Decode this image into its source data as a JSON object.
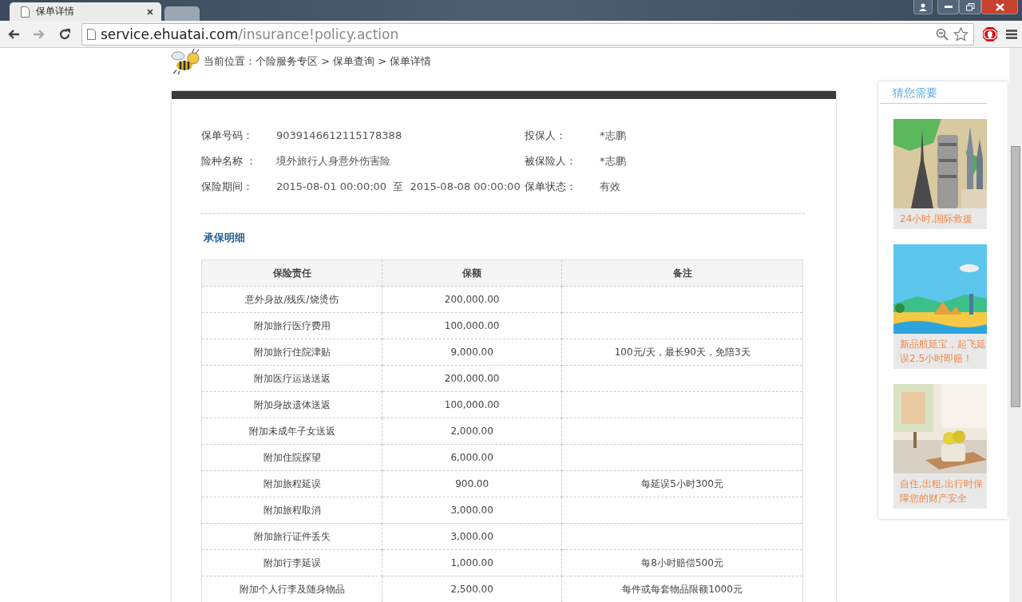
{
  "browser": {
    "tabs": [
      {
        "title": "保单详情",
        "selected": true
      },
      {
        "selected": false
      }
    ],
    "url_host": "service.ehuatai.com",
    "url_path": "/insurance!policy.action"
  },
  "breadcrumb": "当前位置：个险服务专区 > 保单查询 > 保单详情",
  "policy_fields": [
    {
      "label": "保单号码：",
      "value": "9039146612115178388"
    },
    {
      "label": "投保人：",
      "value": "*志鹏"
    },
    {
      "label": "险种名称 ：",
      "value": "境外旅行人身意外伤害险"
    },
    {
      "label": "被保险人：",
      "value": "*志鹏"
    },
    {
      "label": "保险期间：",
      "value": "2015-08-01 00:00:00  至  2015-08-08 00:00:00"
    },
    {
      "label": "保单状态：",
      "value": "有效"
    }
  ],
  "section_title": "承保明细",
  "table": {
    "columns": [
      "保险责任",
      "保额",
      "备注"
    ],
    "rows": [
      [
        "意外身故/残疾/烧烫伤",
        "200,000.00",
        ""
      ],
      [
        "附加旅行医疗费用",
        "100,000.00",
        ""
      ],
      [
        "附加旅行住院津贴",
        "9,000.00",
        "100元/天，最长90天，免陪3天"
      ],
      [
        "附加医疗运送送返",
        "200,000.00",
        ""
      ],
      [
        "附加身故遗体送返",
        "100,000.00",
        ""
      ],
      [
        "附加未成年子女送返",
        "2,000.00",
        ""
      ],
      [
        "附加住院探望",
        "6,000.00",
        ""
      ],
      [
        "附加旅程延误",
        "900.00",
        "每延误5小时300元"
      ],
      [
        "附加旅程取消",
        "3,000.00",
        ""
      ],
      [
        "附加旅行证件丢失",
        "3,000.00",
        ""
      ],
      [
        "附加行李延误",
        "1,000.00",
        "每8小时赔偿500元"
      ],
      [
        "附加个人行李及随身物品",
        "2,500.00",
        "每件或每套物品限额1000元"
      ]
    ]
  },
  "sidebar": {
    "title": "猜您需要",
    "items": [
      {
        "kind": "landmarks",
        "caption": "24小时,国际救援"
      },
      {
        "kind": "beach",
        "caption": "新品航延宝，起飞延误2.5小时即赔！"
      },
      {
        "kind": "interior",
        "caption": "自住,出租,出行时保障您的财产安全"
      }
    ]
  }
}
